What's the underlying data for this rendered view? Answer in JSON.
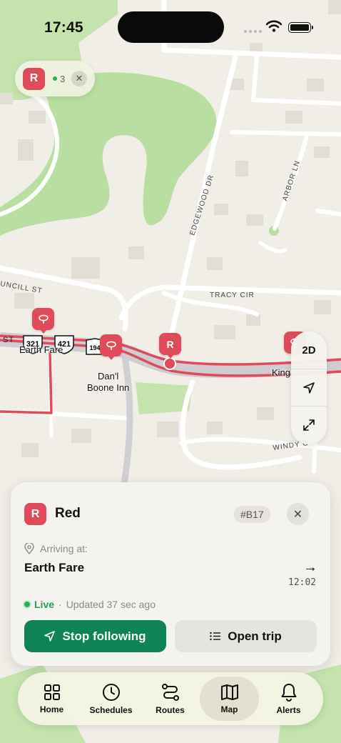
{
  "status_bar": {
    "time": "17:45"
  },
  "route_chip": {
    "badge": "R",
    "count": "3"
  },
  "map": {
    "streets": [
      "EDGEWOOD DR",
      "ARBOR LN",
      "TRACY CIR",
      "UNCILL ST",
      "WINDY G",
      "ST"
    ],
    "places": [
      "Earth Fare",
      "Dan'l\nBoone Inn",
      "King"
    ],
    "shields": [
      "321",
      "421",
      "194"
    ],
    "vehicle_marker": "R",
    "controls": {
      "view_mode": "2D"
    }
  },
  "sheet": {
    "route_badge": "R",
    "route_name": "Red",
    "vehicle_id": "#B17",
    "arriving_label": "Arriving at:",
    "stop_name": "Earth Fare",
    "eta": "12:02",
    "live_label": "Live",
    "separator": "·",
    "updated_text": "Updated 37 sec ago",
    "primary_button": "Stop following",
    "secondary_button": "Open trip"
  },
  "tabs": [
    {
      "label": "Home",
      "icon": "grid-icon",
      "active": false
    },
    {
      "label": "Schedules",
      "icon": "clock-icon",
      "active": false
    },
    {
      "label": "Routes",
      "icon": "route-icon",
      "active": false
    },
    {
      "label": "Map",
      "icon": "map-icon",
      "active": true
    },
    {
      "label": "Alerts",
      "icon": "bell-icon",
      "active": false
    }
  ],
  "colors": {
    "route_red": "#e04b5b",
    "live_green": "#21b356",
    "primary_green": "#0e8456",
    "map_green": "#b9dea1"
  }
}
